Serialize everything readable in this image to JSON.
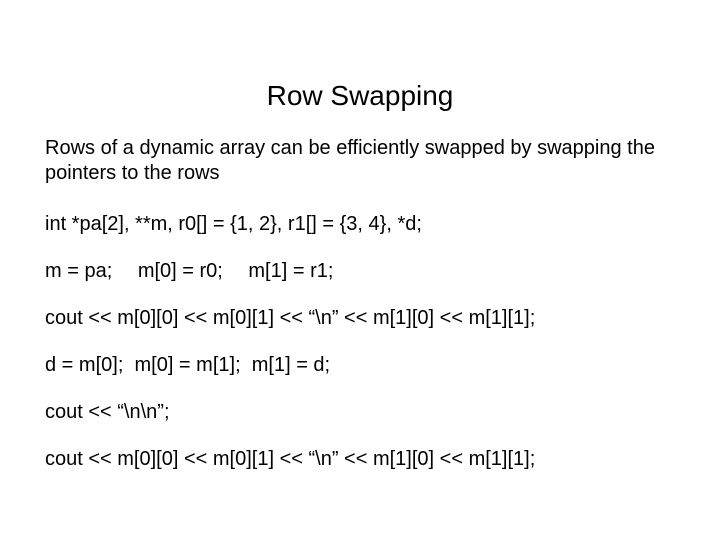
{
  "title": "Row Swapping",
  "intro": "Rows of a dynamic array can be efficiently swapped by swapping the pointers to the rows",
  "lines": [
    "int *pa[2], **m, r0[] = {1, 2}, r1[] = {3, 4}, *d;",
    "m = pa;  m[0] = r0;  m[1] = r1;",
    "cout << m[0][0] << m[0][1] << “\\n” << m[1][0] << m[1][1];",
    "d = m[0];  m[0] = m[1];  m[1] = d;",
    "cout << “\\n\\n”;",
    "cout << m[0][0] << m[0][1] << “\\n” << m[1][0] << m[1][1];"
  ]
}
